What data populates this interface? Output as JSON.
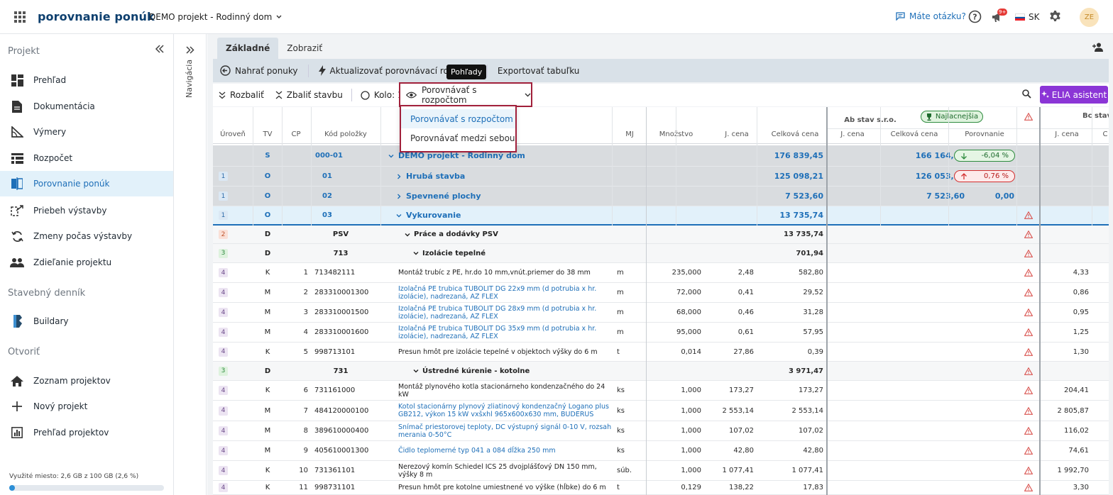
{
  "app_title": "porovnanie ponúk",
  "project_selector": "DEMO projekt - Rodinný dom",
  "help_link": "Máte otázku?",
  "notification_count": "9+",
  "language": "SK",
  "avatar_initials": "ZE",
  "sidebar": {
    "section_project": "Projekt",
    "project_items": [
      {
        "label": "Prehľad",
        "icon": "dashboard-icon"
      },
      {
        "label": "Dokumentácia",
        "icon": "document-icon"
      },
      {
        "label": "Výmery",
        "icon": "measure-icon"
      },
      {
        "label": "Rozpočet",
        "icon": "budget-icon"
      },
      {
        "label": "Porovnanie ponúk",
        "icon": "compare-icon"
      },
      {
        "label": "Priebeh výstavby",
        "icon": "progress-icon"
      },
      {
        "label": "Zmeny počas výstavby",
        "icon": "changes-icon"
      },
      {
        "label": "Zdieľanie projektu",
        "icon": "users-icon"
      }
    ],
    "section_diary": "Stavebný denník",
    "diary_items": [
      {
        "label": "Buildary",
        "icon": "buildary-icon"
      }
    ],
    "section_open": "Otvoriť",
    "open_items": [
      {
        "label": "Zoznam projektov",
        "icon": "home-icon"
      },
      {
        "label": "Nový projekt",
        "icon": "plus-icon"
      },
      {
        "label": "Prehľad projektov",
        "icon": "chart-icon"
      }
    ],
    "storage_text": "Využité miesto: 2,6 GB z 100 GB (2,6 %)",
    "storage_fraction": 0.026
  },
  "navstrip_label": "Navigácia",
  "tabs": [
    "Základné",
    "Zobraziť"
  ],
  "ribbon": {
    "upload_label": "Nahrať ponuky",
    "update_label": "Aktualizovať porovnávací rozpočet",
    "export_label": "Exportovať tabuľku"
  },
  "tooltip": "Pohľady",
  "toolbar": {
    "expand_label": "Rozbaliť",
    "collapse_label": "Zbaliť stavbu",
    "round_label": "Kolo: 1",
    "view_label": "Porovnávať s rozpočtom",
    "elia_label": "ELIA asistent"
  },
  "view_options": [
    "Porovnávať s rozpočtom",
    "Porovnávať medzi sebou"
  ],
  "columns": {
    "level": "Úroveň",
    "tv": "TV",
    "cp": "CP",
    "code": "Kód položky",
    "mj": "MJ",
    "qty": "Množstvo",
    "unit_price": "J. cena",
    "total": "Celková cena",
    "o1_unit": "J. cena",
    "o1_total": "Celková cena",
    "o1_cmp": "Porovnanie",
    "o2_unit": "J. cena",
    "o2_total": "C"
  },
  "offer1": {
    "name": "Ab stav s.r.o.",
    "badge": "Najlacnejšia"
  },
  "offer2": {
    "name": "Bc stav"
  },
  "rows": [
    {
      "lvl": "",
      "tv": "S",
      "cp": "",
      "code": "000-01",
      "name": "DEMO projekt - Rodinný dom",
      "mj": "",
      "qty": "",
      "up": "",
      "total": "176 839,45",
      "o1_total": "166 164,10",
      "cmp": "-6,04 %",
      "cmp_dir": "down",
      "warn": false,
      "o2": "",
      "style": "grey"
    },
    {
      "lvl": "1",
      "tv": "O",
      "cp": "",
      "code": "01",
      "name": "Hrubá stavba",
      "mj": "",
      "qty": "",
      "up": "",
      "total": "125 098,21",
      "o1_total": "126 053,93",
      "cmp": "0,76 %",
      "cmp_dir": "up",
      "warn": false,
      "o2": "",
      "style": "grey"
    },
    {
      "lvl": "1",
      "tv": "O",
      "cp": "",
      "code": "02",
      "name": "Spevnené plochy",
      "mj": "",
      "qty": "",
      "up": "",
      "total": "7 523,60",
      "o1_total": "7 523,60",
      "cmp": "0,00",
      "cmp_dir": "none",
      "warn": false,
      "o2": "",
      "style": "grey"
    },
    {
      "lvl": "1",
      "tv": "O",
      "cp": "",
      "code": "03",
      "name": "Vykurovanie",
      "mj": "",
      "qty": "",
      "up": "",
      "total": "13 735,74",
      "o1_total": "",
      "cmp": "",
      "cmp_dir": "",
      "warn": true,
      "o2": "",
      "style": "selected"
    },
    {
      "lvl": "2",
      "tv": "D",
      "cp": "",
      "code": "PSV",
      "name": "Práce a dodávky PSV",
      "mj": "",
      "qty": "",
      "up": "",
      "total": "13 735,74",
      "o1_total": "",
      "cmp": "",
      "cmp_dir": "",
      "warn": true,
      "o2": "",
      "style": "group"
    },
    {
      "lvl": "3",
      "tv": "D",
      "cp": "",
      "code": "713",
      "name": "Izolácie tepelné",
      "mj": "",
      "qty": "",
      "up": "",
      "total": "701,94",
      "o1_total": "",
      "cmp": "",
      "cmp_dir": "",
      "warn": true,
      "o2": "",
      "style": "group"
    },
    {
      "lvl": "4",
      "tv": "K",
      "cp": "1",
      "code": "713482111",
      "name": "Montáž trubíc z PE, hr.do 10 mm,vnút.priemer do 38 mm",
      "mj": "m",
      "qty": "235,000",
      "up": "2,48",
      "total": "582,80",
      "o1_total": "",
      "cmp": "",
      "cmp_dir": "",
      "warn": true,
      "o2": "4,33",
      "style": "item"
    },
    {
      "lvl": "4",
      "tv": "M",
      "cp": "2",
      "code": "283310001300",
      "name": "Izolačná PE trubica TUBOLIT DG 22x9 mm (d potrubia x hr. izolácie), nadrezaná, AZ FLEX",
      "mj": "m",
      "qty": "72,000",
      "up": "0,41",
      "total": "29,52",
      "o1_total": "",
      "cmp": "",
      "cmp_dir": "",
      "warn": true,
      "o2": "0,86",
      "style": "mat"
    },
    {
      "lvl": "4",
      "tv": "M",
      "cp": "3",
      "code": "283310001500",
      "name": "Izolačná PE trubica TUBOLIT DG 28x9 mm (d potrubia x hr. izolácie), nadrezaná, AZ FLEX",
      "mj": "m",
      "qty": "68,000",
      "up": "0,46",
      "total": "31,28",
      "o1_total": "",
      "cmp": "",
      "cmp_dir": "",
      "warn": true,
      "o2": "0,95",
      "style": "mat"
    },
    {
      "lvl": "4",
      "tv": "M",
      "cp": "4",
      "code": "283310001600",
      "name": "Izolačná PE trubica TUBOLIT DG 35x9 mm (d potrubia x hr. izolácie), nadrezaná, AZ FLEX",
      "mj": "m",
      "qty": "95,000",
      "up": "0,61",
      "total": "57,95",
      "o1_total": "",
      "cmp": "",
      "cmp_dir": "",
      "warn": true,
      "o2": "1,25",
      "style": "mat"
    },
    {
      "lvl": "4",
      "tv": "K",
      "cp": "5",
      "code": "998713101",
      "name": "Presun hmôt pre izolácie tepelné v objektoch výšky do 6 m",
      "mj": "t",
      "qty": "0,014",
      "up": "27,86",
      "total": "0,39",
      "o1_total": "",
      "cmp": "",
      "cmp_dir": "",
      "warn": true,
      "o2": "1,30",
      "style": "item"
    },
    {
      "lvl": "3",
      "tv": "D",
      "cp": "",
      "code": "731",
      "name": "Ústredné kúrenie - kotolne",
      "mj": "",
      "qty": "",
      "up": "",
      "total": "3 971,47",
      "o1_total": "",
      "cmp": "",
      "cmp_dir": "",
      "warn": true,
      "o2": "",
      "style": "group"
    },
    {
      "lvl": "4",
      "tv": "K",
      "cp": "6",
      "code": "731161000",
      "name": "Montáž plynového kotla stacionárneho kondenzačného do 24 kW",
      "mj": "ks",
      "qty": "1,000",
      "up": "173,27",
      "total": "173,27",
      "o1_total": "",
      "cmp": "",
      "cmp_dir": "",
      "warn": true,
      "o2": "204,41",
      "style": "item"
    },
    {
      "lvl": "4",
      "tv": "M",
      "cp": "7",
      "code": "484120000100",
      "name": "Kotol stacionárny plynový zliatinový kondenzačný Logano plus GB212, výkon 15 kW vxšxhl 965x600x630 mm, BUDERUS",
      "mj": "ks",
      "qty": "1,000",
      "up": "2 553,14",
      "total": "2 553,14",
      "o1_total": "",
      "cmp": "",
      "cmp_dir": "",
      "warn": true,
      "o2": "2 805,87",
      "style": "mat"
    },
    {
      "lvl": "4",
      "tv": "M",
      "cp": "8",
      "code": "389610000400",
      "name": "Snímač priestorovej teploty, DC výstupný signál 0-10 V, rozsah merania 0-50°C",
      "mj": "ks",
      "qty": "1,000",
      "up": "107,02",
      "total": "107,02",
      "o1_total": "",
      "cmp": "",
      "cmp_dir": "",
      "warn": true,
      "o2": "116,02",
      "style": "mat"
    },
    {
      "lvl": "4",
      "tv": "M",
      "cp": "9",
      "code": "405610001300",
      "name": "Čidlo teplomerné typ 041 a 084 dĺžka 250 mm",
      "mj": "ks",
      "qty": "1,000",
      "up": "42,80",
      "total": "42,80",
      "o1_total": "",
      "cmp": "",
      "cmp_dir": "",
      "warn": true,
      "o2": "74,61",
      "style": "mat"
    },
    {
      "lvl": "4",
      "tv": "K",
      "cp": "10",
      "code": "731361101",
      "name": "Nerezový komín Schiedel ICS 25 dvojplášťový DN 150 mm, výšky 8 m",
      "mj": "súb.",
      "qty": "1,000",
      "up": "1 077,41",
      "total": "1 077,41",
      "o1_total": "",
      "cmp": "",
      "cmp_dir": "",
      "warn": true,
      "o2": "1 992,70",
      "style": "item"
    },
    {
      "lvl": "4",
      "tv": "K",
      "cp": "11",
      "code": "998731101",
      "name": "Presun hmôt pre kotolne umiestnené vo výške (hĺbke) do 6 m",
      "mj": "t",
      "qty": "0,129",
      "up": "138,22",
      "total": "17,83",
      "o1_total": "",
      "cmp": "",
      "cmp_dir": "",
      "warn": true,
      "o2": "3,30",
      "style": "item"
    }
  ],
  "colors": {
    "accent": "#1e6fb8",
    "brand_dark": "#0d3f6e",
    "highlight_border": "#a1203b",
    "elia": "#8b35d6",
    "warn": "#d9534f",
    "good": "#2e8b3e",
    "bad": "#d32f2f"
  }
}
